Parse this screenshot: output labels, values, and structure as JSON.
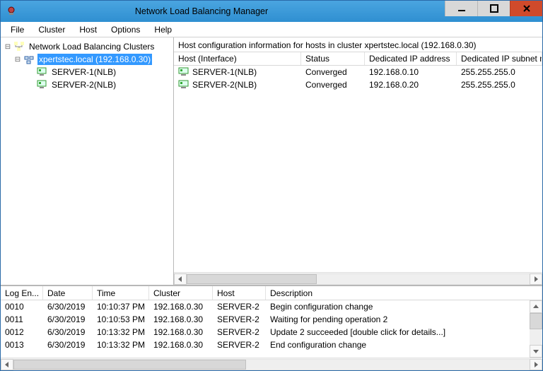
{
  "title": "Network Load Balancing Manager",
  "menu": {
    "file": "File",
    "cluster": "Cluster",
    "host": "Host",
    "options": "Options",
    "help": "Help"
  },
  "tree": {
    "root": "Network Load Balancing Clusters",
    "cluster": "xpertstec.local (192.168.0.30)",
    "hosts": [
      "SERVER-1(NLB)",
      "SERVER-2(NLB)"
    ]
  },
  "detail": {
    "header": "Host configuration information for hosts in cluster xpertstec.local (192.168.0.30)",
    "columns": {
      "c1": "Host (Interface)",
      "c2": "Status",
      "c3": "Dedicated IP address",
      "c4": "Dedicated IP subnet m"
    },
    "rows": [
      {
        "host": "SERVER-1(NLB)",
        "status": "Converged",
        "ip": "192.168.0.10",
        "mask": "255.255.255.0"
      },
      {
        "host": "SERVER-2(NLB)",
        "status": "Converged",
        "ip": "192.168.0.20",
        "mask": "255.255.255.0"
      }
    ]
  },
  "log": {
    "columns": {
      "c1": "Log En...",
      "c2": "Date",
      "c3": "Time",
      "c4": "Cluster",
      "c5": "Host",
      "c6": "Description"
    },
    "rows": [
      {
        "id": "0010",
        "date": "6/30/2019",
        "time": "10:10:37 PM",
        "cluster": "192.168.0.30",
        "host": "SERVER-2",
        "desc": "Begin configuration change"
      },
      {
        "id": "0011",
        "date": "6/30/2019",
        "time": "10:10:53 PM",
        "cluster": "192.168.0.30",
        "host": "SERVER-2",
        "desc": "Waiting for pending operation 2"
      },
      {
        "id": "0012",
        "date": "6/30/2019",
        "time": "10:13:32 PM",
        "cluster": "192.168.0.30",
        "host": "SERVER-2",
        "desc": "Update 2 succeeded [double click for details...]"
      },
      {
        "id": "0013",
        "date": "6/30/2019",
        "time": "10:13:32 PM",
        "cluster": "192.168.0.30",
        "host": "SERVER-2",
        "desc": "End configuration change"
      }
    ]
  }
}
